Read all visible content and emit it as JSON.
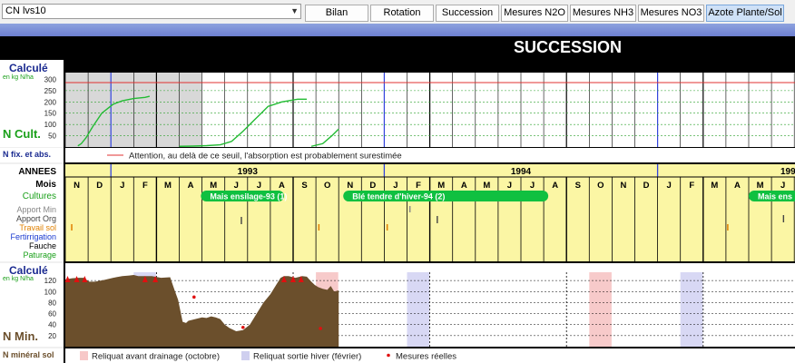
{
  "toolbar": {
    "selector_value": "CN lvs10",
    "tabs": [
      "Bilan",
      "Rotation",
      "Succession",
      "Mesures N2O",
      "Mesures NH3",
      "Mesures NO3",
      "Azote Plante/Sol"
    ],
    "active_tab": "Azote Plante/Sol"
  },
  "page_title": "SUCCESSION",
  "n_cult_panel": {
    "calc_label": "Calculé",
    "unit_label": "en kg N/ha",
    "side_label": "N Cult.",
    "y_ticks": [
      "300",
      "250",
      "200",
      "150",
      "100",
      "50"
    ],
    "threshold_note": "Attention, au delà de ce seuil, l'absorption est probablement surestimée",
    "fix_label": "N fix. et abs."
  },
  "calendar": {
    "row_labels": {
      "years": "ANNEES",
      "months": "Mois",
      "cultures": "Cultures",
      "apport_min": "Apport Min",
      "apport_org": "Apport Org",
      "travail_sol": "Travail sol",
      "fertirrigation": "Fertirrigation",
      "fauche": "Fauche",
      "paturage": "Paturage"
    },
    "years": [
      "1993",
      "1994",
      "199"
    ],
    "months": [
      "N",
      "D",
      "J",
      "F",
      "M",
      "A",
      "M",
      "J",
      "J",
      "A",
      "S",
      "O",
      "N",
      "D",
      "J",
      "F",
      "M",
      "A",
      "M",
      "J",
      "J",
      "A",
      "S",
      "O",
      "N",
      "D",
      "J",
      "F",
      "M",
      "A",
      "M",
      "J"
    ],
    "cultures": [
      "Mais ensilage-93 (1)",
      "Blé tendre d'hiver-94 (2)",
      "Mais ens"
    ]
  },
  "n_min_panel": {
    "calc_label": "Calculé",
    "unit_label": "en kg N/ha",
    "side_label": "N Min.",
    "y_ticks": [
      "120",
      "100",
      "80",
      "60",
      "40",
      "20"
    ],
    "bottom_label": "N minéral sol",
    "legend": {
      "drainage": "Reliquat avant drainage (octobre)",
      "sortie_hiver": "Reliquat sortie hiver (février)",
      "mesures": "Mesures réelles"
    }
  },
  "colors": {
    "soil_brown": "#6b4f2c",
    "crop_green": "#10c040",
    "calendar_yellow": "#fbf6a4",
    "threshold_red": "#e03030",
    "curve_green": "#22bb33",
    "label_navy": "#1a2a90",
    "label_green": "#1aa01a"
  },
  "chart_data": [
    {
      "type": "line",
      "ylabel": "en kg N/ha",
      "ylim": [
        0,
        330
      ],
      "threshold": 300,
      "series": [
        {
          "x": [
            0.55,
            0.7,
            0.9,
            1.2,
            1.6,
            2.1,
            2.5,
            3.0,
            3.5,
            3.7
          ],
          "y": [
            5,
            15,
            40,
            90,
            150,
            190,
            205,
            215,
            220,
            225
          ]
        },
        {
          "x": [
            5.0,
            5.6,
            6.2,
            6.8,
            7.3,
            7.8,
            8.3,
            8.7,
            8.9,
            9.2,
            9.5,
            10.2,
            10.6
          ],
          "y": [
            3,
            4,
            6,
            10,
            25,
            70,
            120,
            160,
            180,
            190,
            200,
            212,
            212
          ]
        },
        {
          "x": [
            10.8,
            11.3,
            11.7,
            12.0
          ],
          "y": [
            3,
            15,
            50,
            80
          ]
        }
      ]
    },
    {
      "type": "area",
      "ylabel": "en kg N/ha",
      "ylim": [
        0,
        135
      ],
      "x": [
        0.0,
        0.3,
        0.6,
        0.8,
        1.05,
        1.3,
        1.7,
        2.1,
        2.5,
        2.8,
        3.0,
        3.2,
        3.5,
        3.8,
        4.2,
        4.6,
        4.8,
        4.95,
        5.1,
        5.15,
        5.3,
        5.4,
        5.6,
        5.8,
        6.0,
        6.2,
        6.4,
        6.6,
        6.8,
        7.0,
        7.2,
        7.5,
        7.8,
        8.1,
        8.4,
        8.7,
        9.0,
        9.3,
        9.45,
        9.6,
        9.8,
        10.1,
        10.4,
        10.6,
        10.8,
        10.95,
        11.1,
        11.3,
        11.5,
        11.65,
        11.8,
        12.0
      ],
      "values": [
        122,
        124,
        125,
        125,
        118,
        118,
        121,
        125,
        128,
        129,
        130,
        128,
        128,
        128,
        125,
        126,
        102,
        85,
        55,
        45,
        43,
        47,
        49,
        51,
        53,
        52,
        55,
        53,
        50,
        40,
        34,
        28,
        30,
        40,
        60,
        80,
        95,
        115,
        125,
        128,
        128,
        125,
        128,
        127,
        118,
        112,
        108,
        105,
        103,
        110,
        100,
        102
      ],
      "measures": [
        {
          "x": 5.65,
          "y": 90
        },
        {
          "x": 7.8,
          "y": 35
        },
        {
          "x": 11.2,
          "y": 33
        }
      ],
      "top_markers_x": [
        0.1,
        0.5,
        0.85,
        3.5,
        3.95,
        9.6,
        10.0,
        10.35
      ]
    }
  ]
}
